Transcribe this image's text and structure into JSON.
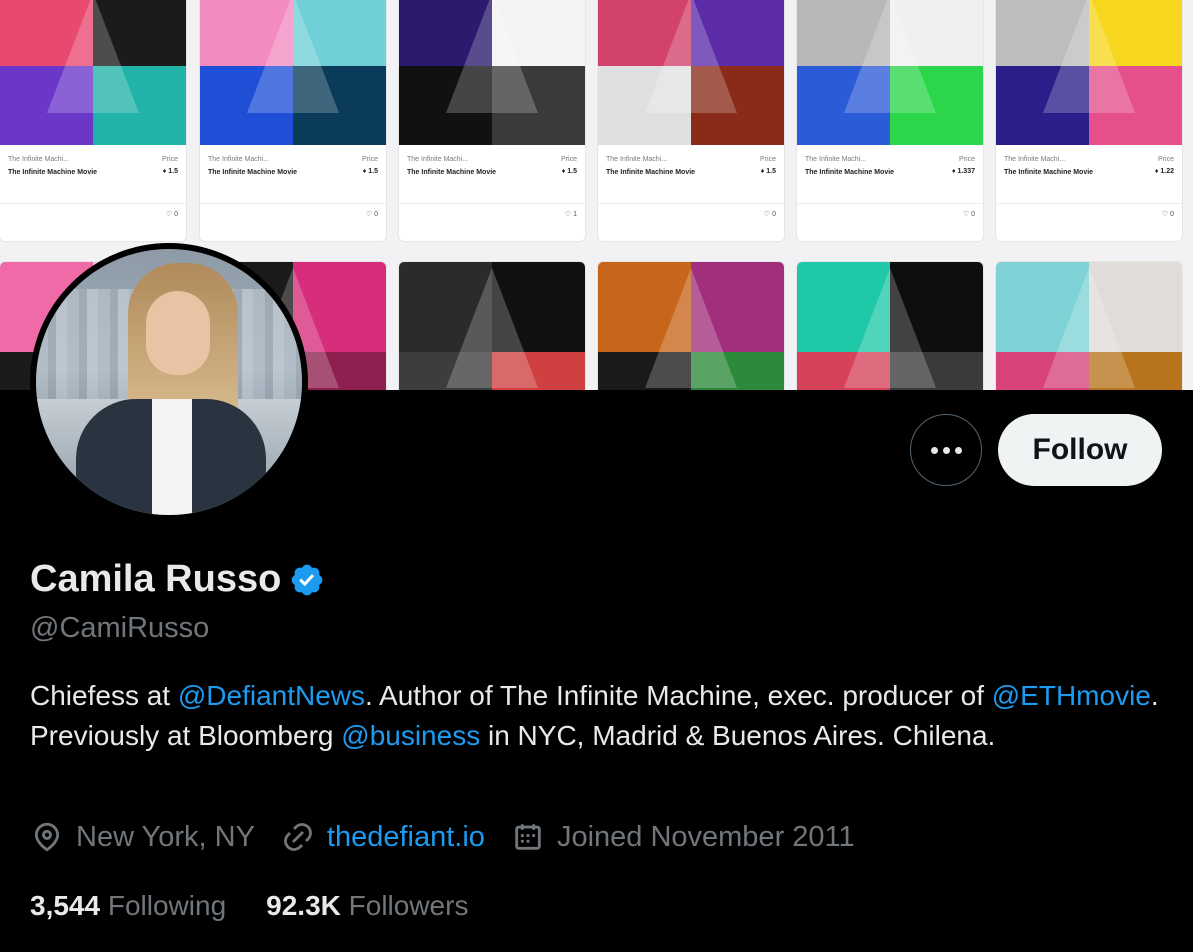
{
  "banner": {
    "cards": [
      {
        "collection": "The Infinite Machi...",
        "name": "The Infinite Machine Movie",
        "price_label": "Price",
        "price": "1.5",
        "likes": "0",
        "colors": [
          "#e8496f",
          "#1b1b1b",
          "#6b37c9",
          "#22b3a8"
        ]
      },
      {
        "collection": "The Infinite Machi...",
        "name": "The Infinite Machine Movie",
        "price_label": "Price",
        "price": "1.5",
        "likes": "0",
        "colors": [
          "#f28cc0",
          "#6fd0d7",
          "#1e4fd6",
          "#0b3b5a"
        ]
      },
      {
        "collection": "The Infinite Machi...",
        "name": "The Infinite Machine Movie",
        "price_label": "Price",
        "price": "1.5",
        "likes": "1",
        "colors": [
          "#2b1a6e",
          "#f4f4f4",
          "#111111",
          "#3a3a3a"
        ]
      },
      {
        "collection": "The Infinite Machi...",
        "name": "The Infinite Machine Movie",
        "price_label": "Price",
        "price": "1.5",
        "likes": "0",
        "colors": [
          "#d3426b",
          "#5b2ba8",
          "#e0e0e0",
          "#8a2b1a"
        ]
      },
      {
        "collection": "The Infinite Machi...",
        "name": "The Infinite Machine Movie",
        "price_label": "Price",
        "price": "1.337",
        "likes": "0",
        "colors": [
          "#b8b8b8",
          "#f0f0f0",
          "#2c5bd8",
          "#2bd64a"
        ]
      },
      {
        "collection": "The Infinite Machi...",
        "name": "The Infinite Machine Movie",
        "price_label": "Price",
        "price": "1.22",
        "likes": "0",
        "colors": [
          "#bdbdbd",
          "#f6d61e",
          "#2a1f8a",
          "#e54f8c"
        ]
      },
      {
        "collection": "",
        "name": "",
        "price_label": "",
        "price": "",
        "likes": "",
        "colors": [
          "#f06aa8",
          "#f5c4d0",
          "#1b1b1b",
          "#c7c7c7"
        ]
      },
      {
        "collection": "",
        "name": "",
        "price_label": "",
        "price": "",
        "likes": "",
        "colors": [
          "#1a1a1a",
          "#d62e7a",
          "#2a2a2a",
          "#8f1f50"
        ]
      },
      {
        "collection": "",
        "name": "",
        "price_label": "",
        "price": "",
        "likes": "",
        "colors": [
          "#2b2b2b",
          "#101010",
          "#3d3d3d",
          "#d04040"
        ]
      },
      {
        "collection": "",
        "name": "",
        "price_label": "",
        "price": "",
        "likes": "",
        "colors": [
          "#c7661a",
          "#a22f7b",
          "#1a1a1a",
          "#2b8b3a"
        ]
      },
      {
        "collection": "",
        "name": "",
        "price_label": "",
        "price": "",
        "likes": "",
        "colors": [
          "#1fc9a8",
          "#0e0e0e",
          "#d6425a",
          "#3a3a3a"
        ]
      },
      {
        "collection": "",
        "name": "",
        "price_label": "",
        "price": "",
        "likes": "",
        "colors": [
          "#7fd3d6",
          "#e0dcd8",
          "#d7437a",
          "#b8731d"
        ]
      }
    ]
  },
  "profile": {
    "display_name": "Camila Russo",
    "handle": "@CamiRusso",
    "bio": {
      "p1": "Chiefess at ",
      "m1": "@DefiantNews",
      "p2": ". Author of The Infinite Machine, exec. producer of ",
      "m2": "@ETHmovie",
      "p3": ". Previously at Bloomberg ",
      "m3": "@business",
      "p4": " in NYC, Madrid & Buenos Aires. Chilena."
    },
    "location": "New York, NY",
    "website": "thedefiant.io",
    "joined": "Joined November 2011",
    "following_count": "3,544",
    "following_label": "Following",
    "followers_count": "92.3K",
    "followers_label": "Followers"
  },
  "actions": {
    "follow_label": "Follow"
  },
  "icons": {
    "location": "location-pin-icon",
    "link": "link-icon",
    "calendar": "calendar-icon",
    "verified": "verified-badge-icon",
    "more": "more-options-icon",
    "heart": "heart-icon",
    "eth": "ethereum-icon"
  },
  "colors": {
    "accent": "#1d9bf0",
    "secondary_text": "#71767b",
    "background": "#000000"
  }
}
